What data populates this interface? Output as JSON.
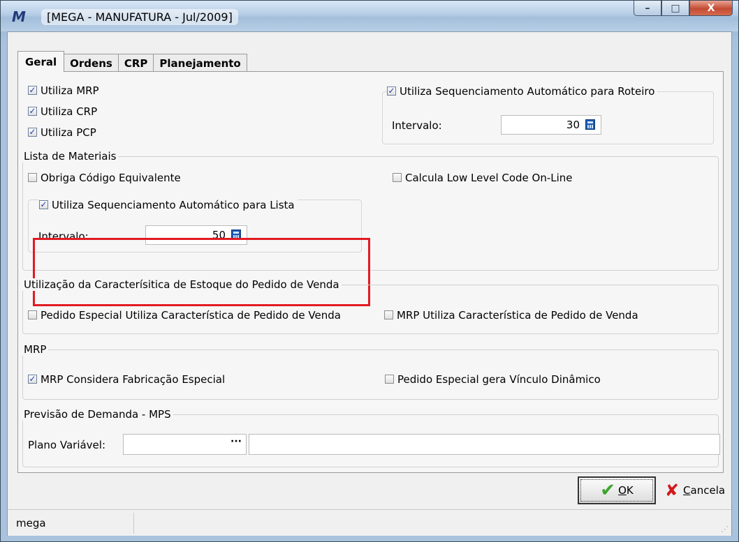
{
  "window": {
    "title": "[MEGA - MANUFATURA - Jul/2009]",
    "app_icon": "mega-logo-icon"
  },
  "caption_buttons": {
    "minimize": "–",
    "maximize": "□",
    "close": "X"
  },
  "tabs": [
    {
      "label": "Geral",
      "active": true
    },
    {
      "label": "Ordens",
      "active": false
    },
    {
      "label": "CRP",
      "active": false
    },
    {
      "label": "Planejamento",
      "active": false
    }
  ],
  "top": {
    "utiliza_mrp": {
      "label": "Utiliza MRP",
      "checked": true
    },
    "utiliza_crp": {
      "label": "Utiliza CRP",
      "checked": true
    },
    "utiliza_pcp": {
      "label": "Utiliza PCP",
      "checked": true
    },
    "roteiro": {
      "checkbox_label": "Utiliza Sequenciamento Automático para Roteiro",
      "checked": true,
      "intervalo_label": "Intervalo:",
      "intervalo_value": "30"
    }
  },
  "lista_materiais": {
    "title": "Lista de Materiais",
    "obriga_codigo": {
      "label": "Obriga Código Equivalente",
      "checked": false
    },
    "calcula_low_level": {
      "label": "Calcula Low Level Code On-Line",
      "checked": false
    },
    "sequenciamento_lista": {
      "checkbox_label": "Utiliza Sequenciamento Automático para Lista",
      "checked": true,
      "intervalo_label": "Intervalo:",
      "intervalo_value": "50"
    }
  },
  "caracteristica": {
    "title": "Utilização da Caracterísitica de Estoque do Pedido de Venda",
    "pedido_especial": {
      "label": "Pedido Especial Utiliza Característica de Pedido de Venda",
      "checked": false
    },
    "mrp_utiliza": {
      "label": "MRP Utiliza Característica de Pedido de Venda",
      "checked": false
    }
  },
  "mrp": {
    "title": "MRP",
    "considera_fabricacao": {
      "label": "MRP Considera Fabricação Especial",
      "checked": true
    },
    "vinculo_dinamico": {
      "label": "Pedido Especial gera Vínculo Dinâmico",
      "checked": false
    }
  },
  "previsao": {
    "title": "Previsão de Demanda - MPS",
    "plano_label": "Plano Variável:",
    "plano_value": "",
    "plano_button": "···",
    "descricao_value": ""
  },
  "buttons": {
    "ok_label_first": "O",
    "ok_label_rest": "K",
    "cancel_label_first": "C",
    "cancel_label_rest": "ancela"
  },
  "status": {
    "text": "mega"
  },
  "colors": {
    "highlight": "#e11b22",
    "ok_check": "#3aa52a",
    "cancel_x": "#d11a1a"
  }
}
